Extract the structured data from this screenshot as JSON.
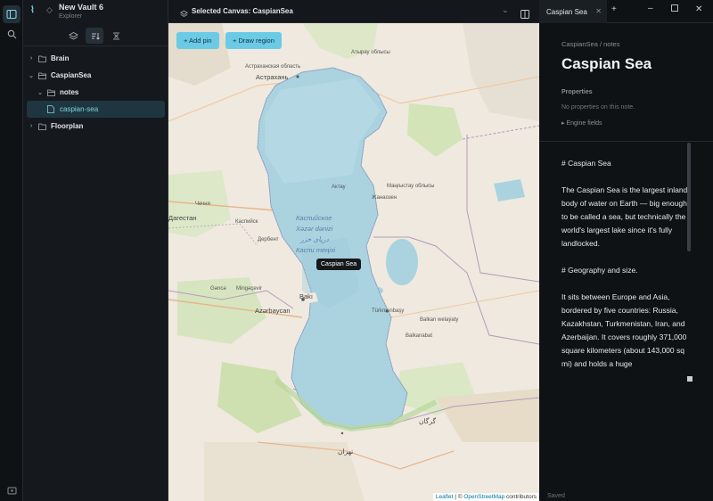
{
  "vault": {
    "name": "New Vault 6",
    "subtitle": "Explorer"
  },
  "tree": [
    {
      "label": "Brain",
      "type": "folder"
    },
    {
      "label": "CaspianSea",
      "type": "folder-open"
    },
    {
      "label": "notes",
      "type": "folder-open"
    },
    {
      "label": "caspian-sea",
      "type": "file",
      "selected": true
    },
    {
      "label": "Floorplan",
      "type": "folder"
    }
  ],
  "center": {
    "title": "Selected Canvas: CaspianSea",
    "add_pin": "+ Add pin",
    "draw_region": "+ Draw region",
    "pin_label": "Caspian Sea",
    "attribution_leaflet": "Leaflet",
    "attribution_sep": " | © ",
    "attribution_osm": "OpenStreetMap",
    "attribution_tail": " contributors"
  },
  "map_labels": {
    "astrakhan": "Астрахань",
    "astrakhan_oblast": "Астраханская область",
    "atyrau_oblast": "Атырау облысы",
    "aktau": "Актау",
    "zhanaozen": "Жанаозен",
    "mangystau": "Маңғыстау облысы",
    "dagestan": "Дагестан",
    "derbent": "Дербент",
    "kaspiysk": "Каспийск",
    "chechnya": "Чечня",
    "ganca": "Gəncə",
    "mingacevir": "Mingəçevir",
    "azerbaycan": "Azərbaycan",
    "baki": "Bakı",
    "turkmenbasy": "Türkmenbaşy",
    "balkanabat": "Balkanabat",
    "balkan_welayaty": "Balkan welaýaty",
    "gurgan": "گرگان",
    "tehran": "تهران",
    "sea_ru": "Каспийское",
    "sea_az": "Xəzər dənizi",
    "sea_fa": "دریای خزر",
    "sea_big": "Каспи теңізі"
  },
  "note": {
    "tab_label": "Caspian Sea",
    "breadcrumb": "CaspianSea / notes",
    "title": "Caspian Sea",
    "properties_label": "Properties",
    "no_properties": "No properties on this note.",
    "engine_fields": "▸ Engine fields",
    "heading1": "# Caspian Sea",
    "para1": "The Caspian Sea is the largest inland body of water on Earth — big enough to be called a sea, but technically the world's largest lake since it's fully landlocked.",
    "heading2": "# Geography and size.",
    "para2": "It sits between Europe and Asia, bordered by five countries: Russia, Kazakhstan, Turkmenistan, Iran, and Azerbaijan. It covers roughly 371,000 square kilometers (about 143,000 sq mi) and holds a huge",
    "status": "Saved"
  },
  "colors": {
    "accent": "#6bcbe6",
    "water": "#aad3df",
    "selected": "#1f3640"
  }
}
